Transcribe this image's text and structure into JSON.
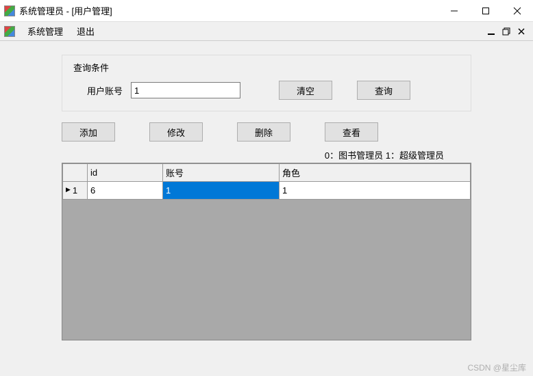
{
  "window": {
    "title": "系统管理员 - [用户管理]"
  },
  "menu": {
    "system": "系统管理",
    "exit": "退出"
  },
  "search": {
    "groupTitle": "查询条件",
    "accountLabel": "用户账号",
    "accountValue": "1",
    "clearBtn": "清空",
    "queryBtn": "查询"
  },
  "actions": {
    "add": "添加",
    "edit": "修改",
    "delete": "删除",
    "view": "查看"
  },
  "legend": "0：图书管理员   1：超级管理员",
  "grid": {
    "headers": {
      "id": "id",
      "account": "账号",
      "role": "角色"
    },
    "rows": [
      {
        "num": "1",
        "id": "6",
        "account": "1",
        "role": "1"
      }
    ]
  },
  "watermark": "CSDN @星尘库"
}
